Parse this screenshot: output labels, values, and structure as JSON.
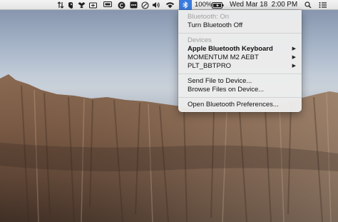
{
  "menubar": {
    "icons": [
      "network-activity-icon",
      "evernote-icon",
      "dropbox-icon",
      "battery-health-icon",
      "display-icon",
      "creative-cloud-icon",
      "lastpass-icon",
      "time-machine-icon",
      "volume-icon",
      "wifi-icon",
      "bluetooth-icon"
    ],
    "battery_percent": "100%",
    "datetime": "Wed Mar 18  2:00 PM"
  },
  "bluetooth_menu": {
    "status": "Bluetooth: On",
    "toggle_label": "Turn Bluetooth Off",
    "devices_header": "Devices",
    "devices": [
      {
        "name": "Apple Bluetooth Keyboard"
      },
      {
        "name": "MOMENTUM M2 AEBT"
      },
      {
        "name": "PLT_BBTPRO"
      }
    ],
    "send_file": "Send File to Device...",
    "browse_files": "Browse Files on Device...",
    "preferences": "Open Bluetooth Preferences..."
  }
}
